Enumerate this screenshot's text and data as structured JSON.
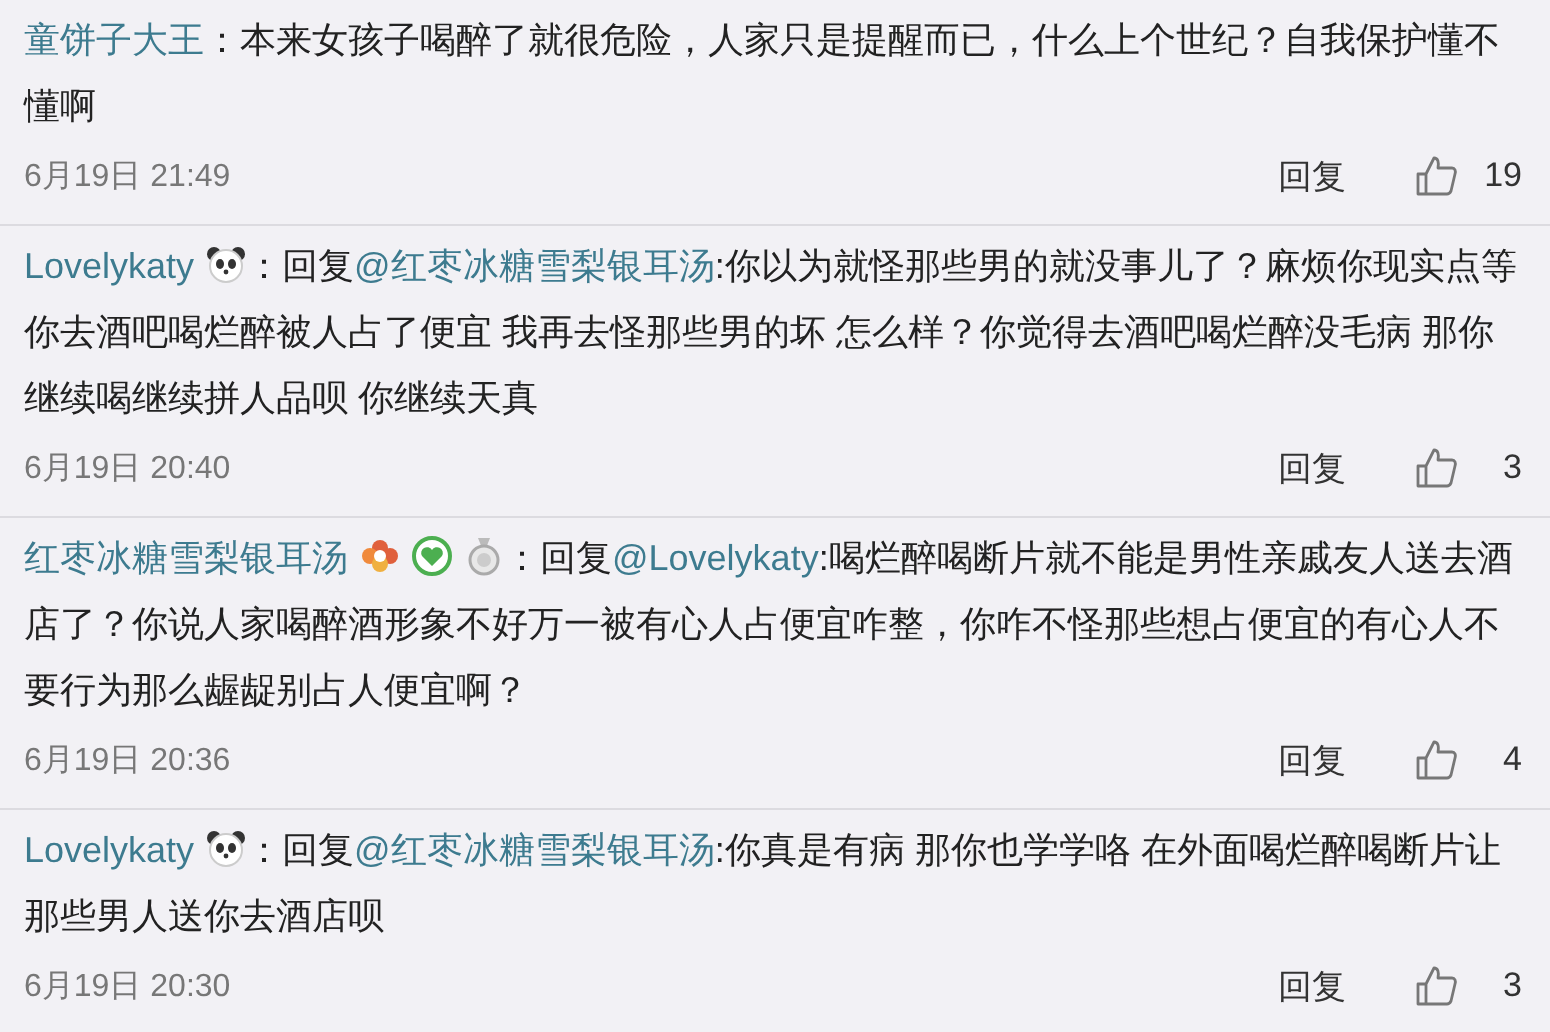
{
  "comments": [
    {
      "author": "童饼子大王",
      "prefix": "：",
      "text": "本来女孩子喝醉了就很危险，人家只是提醒而已，什么上个世纪？自我保护懂不懂啊",
      "date": "6月19日 21:49",
      "reply": "回复",
      "likes": "19"
    },
    {
      "author": "Lovelykaty",
      "badges": [
        {
          "kind": "panda"
        }
      ],
      "prefix": "：回复",
      "mention": "@红枣冰糖雪梨银耳汤",
      "text": ":你以为就怪那些男的就没事儿了？麻烦你现实点等你去酒吧喝烂醉被人占了便宜 我再去怪那些男的坏 怎么样？你觉得去酒吧喝烂醉没毛病 那你继续喝继续拼人品呗 你继续天真",
      "date": "6月19日 20:40",
      "reply": "回复",
      "likes": "3"
    },
    {
      "author": "红枣冰糖雪梨银耳汤",
      "badges": [
        {
          "kind": "flower"
        },
        {
          "kind": "heart"
        },
        {
          "kind": "medal"
        }
      ],
      "prefix": "：回复",
      "mention": "@Lovelykaty",
      "text": ":喝烂醉喝断片就不能是男性亲戚友人送去酒店了？你说人家喝醉酒形象不好万一被有心人占便宜咋整，你咋不怪那些想占便宜的有心人不要行为那么龌龊别占人便宜啊？",
      "date": "6月19日 20:36",
      "reply": "回复",
      "likes": "4"
    },
    {
      "author": "Lovelykaty",
      "badges": [
        {
          "kind": "panda"
        }
      ],
      "prefix": "：回复",
      "mention": "@红枣冰糖雪梨银耳汤",
      "text": ":你真是有病 那你也学学咯 在外面喝烂醉喝断片让那些男人送你去酒店呗",
      "date": "6月19日 20:30",
      "reply": "回复",
      "likes": "3"
    }
  ]
}
